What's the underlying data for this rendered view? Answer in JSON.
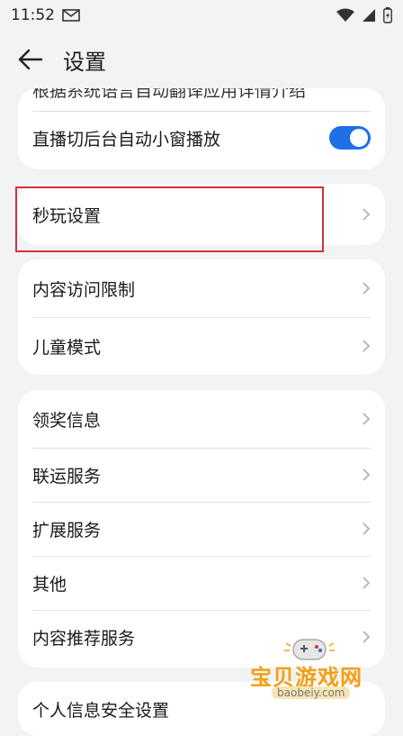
{
  "status_bar": {
    "time": "11:52"
  },
  "header": {
    "title": "设置"
  },
  "top_card": {
    "cut_text": "根据系统语言自动翻译应用详情介绍",
    "pip_label": "直播切后台自动小窗播放",
    "pip_enabled": true
  },
  "card_quick_play": {
    "label": "秒玩设置"
  },
  "card_restrictions": {
    "items": [
      {
        "label": "内容访问限制"
      },
      {
        "label": "儿童模式"
      }
    ]
  },
  "card_services": {
    "items": [
      {
        "label": "领奖信息"
      },
      {
        "label": "联运服务"
      },
      {
        "label": "扩展服务"
      },
      {
        "label": "其他"
      },
      {
        "label": "内容推荐服务"
      }
    ]
  },
  "card_privacy": {
    "label": "个人信息安全设置"
  },
  "watermark": {
    "text": "宝贝游戏网",
    "url": "baobeiy.com"
  },
  "colors": {
    "accent": "#1e6fe8",
    "highlight": "#d0323a",
    "background": "#f1f3f5"
  }
}
